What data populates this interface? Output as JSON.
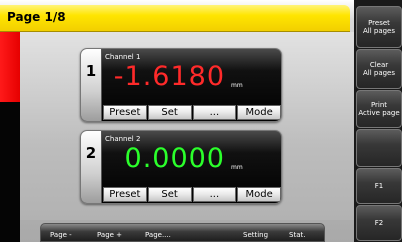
{
  "header": {
    "page_label": "Page 1/8"
  },
  "channels": [
    {
      "number": "1",
      "name": "Channel 1",
      "value": "-1.6180",
      "unit": "mm",
      "buttons": [
        "Preset",
        "Set",
        "...",
        "Mode"
      ]
    },
    {
      "number": "2",
      "name": "Channel 2",
      "value": "0.0000",
      "unit": "mm",
      "buttons": [
        "Preset",
        "Set",
        "...",
        "Mode"
      ]
    }
  ],
  "softkeys": [
    {
      "line1": "Preset",
      "line2": "All pages"
    },
    {
      "line1": "Clear",
      "line2": "All pages"
    },
    {
      "line1": "Print",
      "line2": "Active page"
    },
    {
      "line1": "",
      "line2": ""
    },
    {
      "line1": "F1",
      "line2": ""
    },
    {
      "line1": "F2",
      "line2": ""
    }
  ],
  "bottom_bar": {
    "page_minus": "Page -",
    "page_plus": "Page +",
    "page_more": "Page....",
    "setting": "Setting",
    "stat": "Stat."
  },
  "colors": {
    "header": "#ffe500",
    "channel_1_value": "#ff2a2a",
    "channel_2_value": "#2bff2b",
    "indicator": "#e60000"
  }
}
